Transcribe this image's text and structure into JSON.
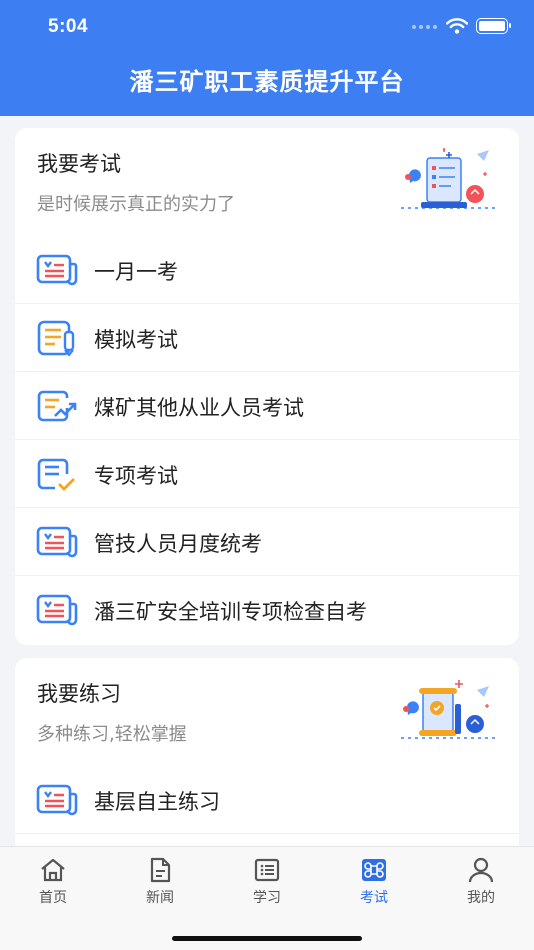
{
  "status_bar": {
    "time": "5:04"
  },
  "header": {
    "title": "潘三矿职工素质提升平台"
  },
  "exam_section": {
    "title": "我要考试",
    "subtitle": "是时候展示真正的实力了",
    "illustration_icon": "exam-paper-illustration",
    "items": [
      {
        "label": "一月一考",
        "icon": "newspaper-icon"
      },
      {
        "label": "模拟考试",
        "icon": "document-pen-icon"
      },
      {
        "label": "煤矿其他从业人员考试",
        "icon": "document-trend-icon"
      },
      {
        "label": "专项考试",
        "icon": "document-check-icon"
      },
      {
        "label": "管技人员月度统考",
        "icon": "newspaper-icon"
      },
      {
        "label": "潘三矿安全培训专项检查自考",
        "icon": "newspaper-icon"
      }
    ]
  },
  "practice_section": {
    "title": "我要练习",
    "subtitle": "多种练习,轻松掌握",
    "illustration_icon": "scroll-practice-illustration",
    "items": [
      {
        "label": "基层自主练习",
        "icon": "newspaper-icon"
      }
    ]
  },
  "tabbar": {
    "active": "考试",
    "tabs": [
      {
        "label": "首页",
        "icon": "home-icon"
      },
      {
        "label": "新闻",
        "icon": "news-icon"
      },
      {
        "label": "学习",
        "icon": "study-icon"
      },
      {
        "label": "考试",
        "icon": "command-icon"
      },
      {
        "label": "我的",
        "icon": "person-icon"
      }
    ]
  },
  "colors": {
    "brand_blue": "#3d7ff2",
    "icon_blue": "#3b82f6",
    "icon_orange": "#f5a524",
    "icon_red": "#f0535a",
    "tab_active": "#2f6fe6"
  }
}
